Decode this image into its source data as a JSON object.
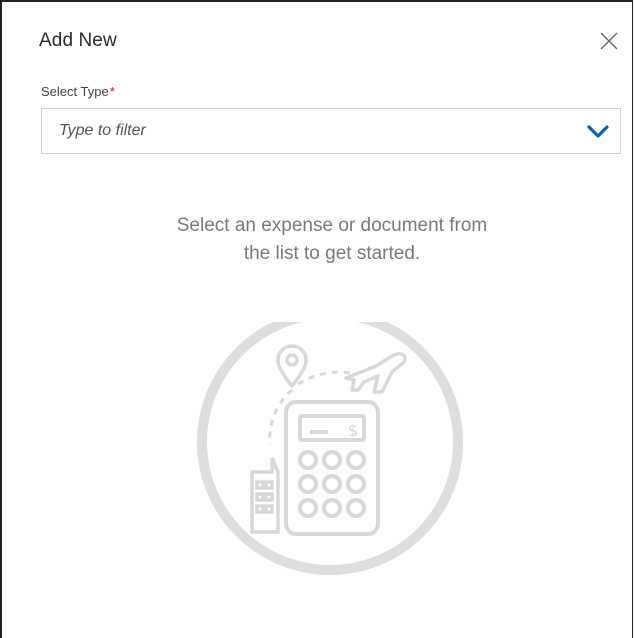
{
  "dialog": {
    "title": "Add New",
    "close_icon": "close-icon"
  },
  "select_type": {
    "label": "Select Type",
    "required_mark": "*",
    "placeholder": "Type to filter",
    "value": "",
    "dropdown_icon": "chevron-down-icon"
  },
  "empty_state": {
    "line1": "Select an expense or document from",
    "line2": "the list to get started.",
    "icon": "expense-calculator-illustration"
  },
  "colors": {
    "accent": "#0b5fb3",
    "required": "#c8102e",
    "muted_text": "#7a7a7a",
    "illustration": "#dcdcdc"
  }
}
